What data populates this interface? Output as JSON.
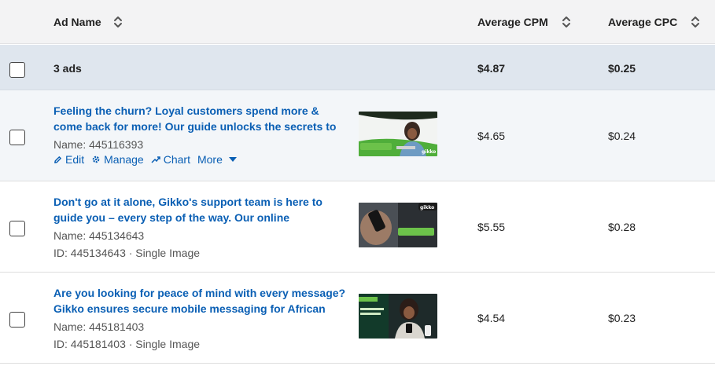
{
  "header": {
    "col_name": "Ad Name",
    "col_cpm": "Average CPM",
    "col_cpc": "Average CPC"
  },
  "summary": {
    "count": "3 ads",
    "cpm": "$4.87",
    "cpc": "$0.25"
  },
  "actions": {
    "edit": "Edit",
    "manage": "Manage",
    "chart": "Chart",
    "more": "More"
  },
  "rows": [
    {
      "title": "Feeling the churn? Loyal customers spend more & come back for more! Our guide unlocks the secrets to",
      "name": "Name: 445116393",
      "cpm": "$4.65",
      "cpc": "$0.24"
    },
    {
      "title": "Don't go at it alone, Gikko's support team is here to guide you – every step of the way. Our online",
      "name": "Name: 445134643",
      "id_line": "ID: 445134643 · Single Image",
      "cpm": "$5.55",
      "cpc": "$0.28"
    },
    {
      "title": "Are you looking for peace of mind with every message? Gikko ensures secure mobile messaging for African",
      "name": "Name: 445181403",
      "id_line": "ID: 445181403 · Single Image",
      "cpm": "$4.54",
      "cpc": "$0.23"
    }
  ],
  "colors": {
    "link": "#0a5fb4",
    "header_bg": "#f3f3f4",
    "summary_bg": "#dfe6ee",
    "brand_green": "#6cc24a"
  }
}
